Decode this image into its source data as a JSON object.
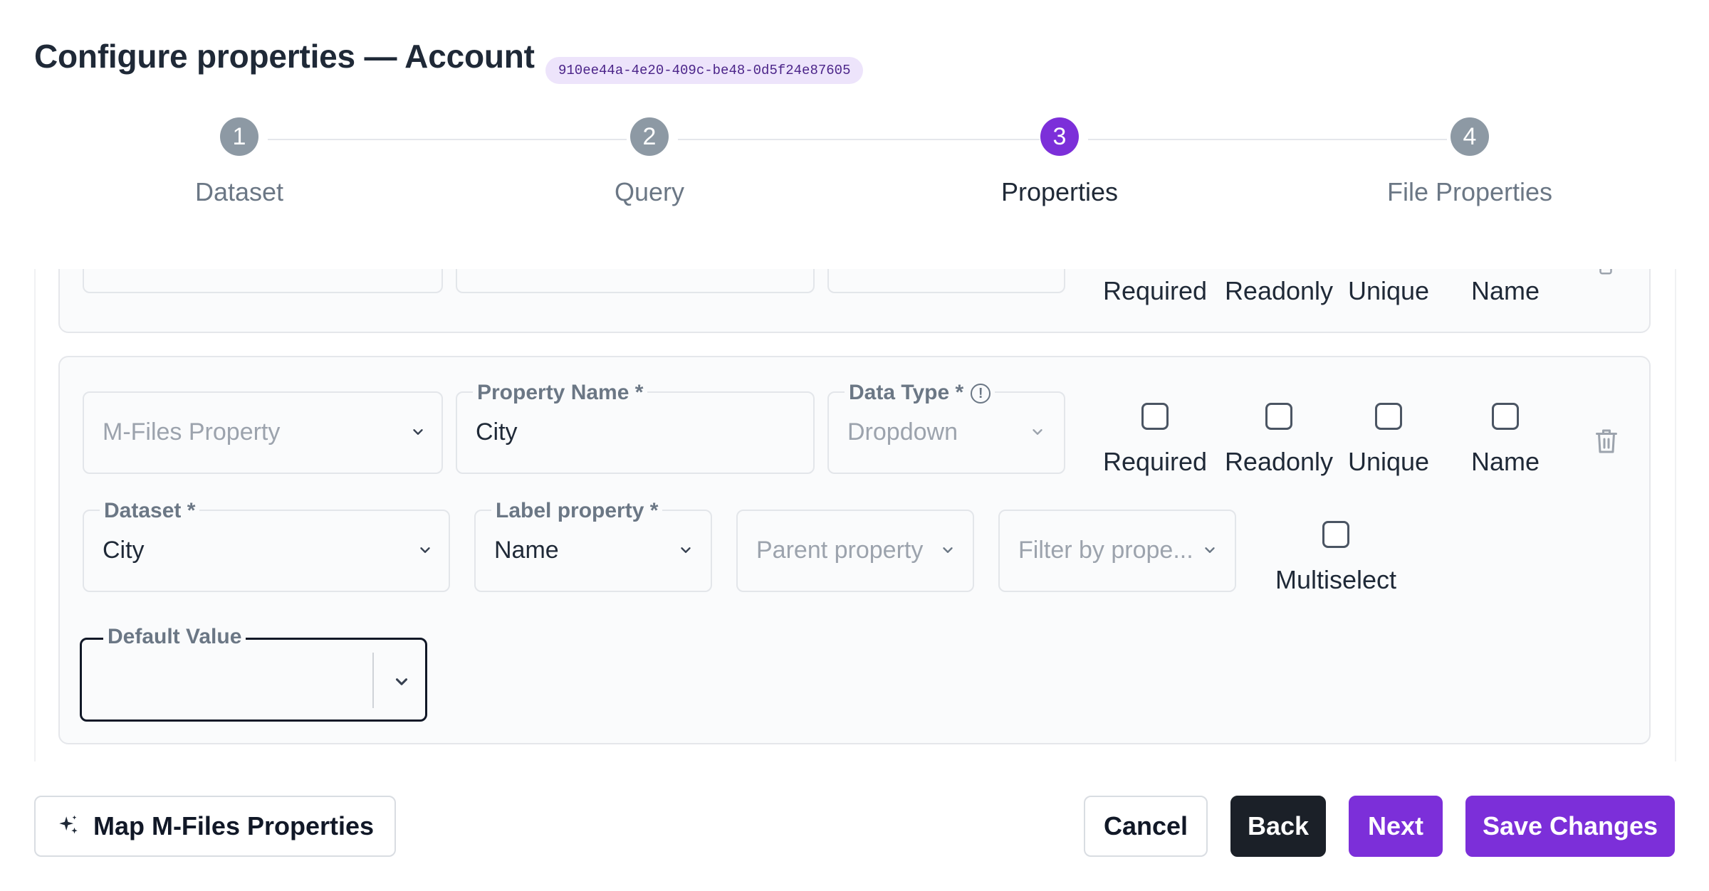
{
  "header": {
    "title": "Configure properties — Account",
    "id_badge": "910ee44a-4e20-409c-be48-0d5f24e87605"
  },
  "stepper": {
    "steps": [
      {
        "number": "1",
        "label": "Dataset",
        "state": "complete"
      },
      {
        "number": "2",
        "label": "Query",
        "state": "complete"
      },
      {
        "number": "3",
        "label": "Properties",
        "state": "active"
      },
      {
        "number": "4",
        "label": "File Properties",
        "state": "upcoming"
      }
    ]
  },
  "prev_card": {
    "checkboxes": [
      "Required",
      "Readonly",
      "Unique",
      "Name"
    ]
  },
  "card": {
    "mfiles_property": {
      "placeholder": "M-Files Property"
    },
    "property_name": {
      "label": "Property Name *",
      "value": "City"
    },
    "data_type": {
      "label": "Data Type *",
      "value": "Dropdown",
      "info_icon": "!"
    },
    "checkboxes": [
      {
        "label": "Required",
        "checked": false
      },
      {
        "label": "Readonly",
        "checked": false
      },
      {
        "label": "Unique",
        "checked": false
      },
      {
        "label": "Name",
        "checked": false
      }
    ],
    "dataset": {
      "label": "Dataset *",
      "value": "City"
    },
    "label_property": {
      "label": "Label property *",
      "value": "Name"
    },
    "parent_property": {
      "placeholder": "Parent property"
    },
    "filter_by_property": {
      "placeholder": "Filter by prope..."
    },
    "multiselect": {
      "label": "Multiselect",
      "checked": false
    },
    "default_value": {
      "label": "Default Value",
      "value": ""
    }
  },
  "footer": {
    "map_button": "Map M-Files Properties",
    "cancel_button": "Cancel",
    "back_button": "Back",
    "next_button": "Next",
    "save_button": "Save Changes"
  },
  "colors": {
    "accent": "#7c2fd9",
    "dark_button": "#1b2028",
    "badge_bg": "#ede4fb",
    "step_inactive": "#8d99a4"
  }
}
